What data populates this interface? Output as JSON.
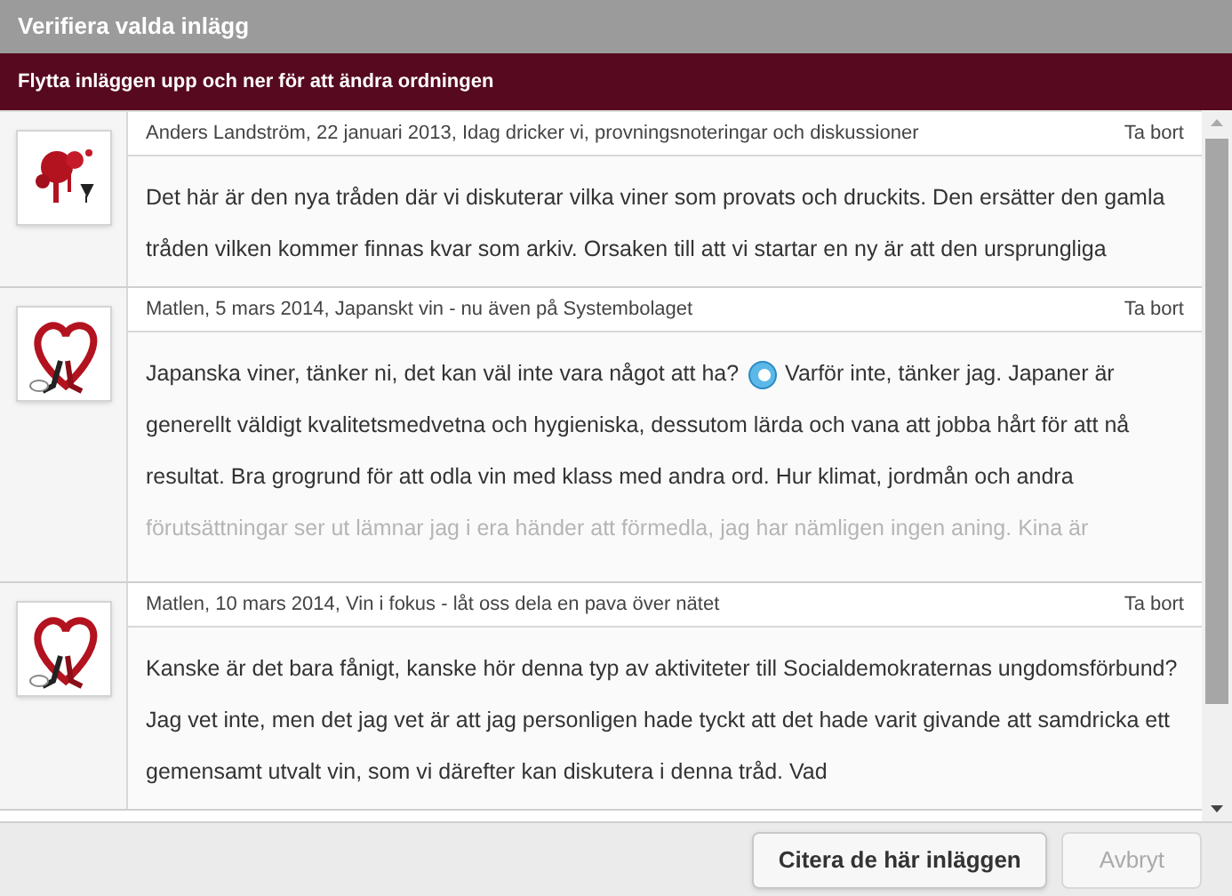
{
  "window": {
    "title": "Verifiera valda inlägg"
  },
  "banner": "Flytta inläggen upp och ner för att ändra ordningen",
  "posts": [
    {
      "avatar": {
        "kind": "splatter"
      },
      "header": "Anders Landström, 22 januari 2013, Idag dricker vi, provningsnoteringar och diskussioner",
      "remove": "Ta bort",
      "faded": false,
      "body": [
        {
          "kind": "text",
          "text": "Det här är den nya tråden där vi diskuterar vilka viner som provats och druckits. Den ersätter den gamla tråden vilken kommer finnas kvar som arkiv. Orsaken till att vi startar en ny är att den ursprungliga"
        }
      ]
    },
    {
      "avatar": {
        "kind": "heart"
      },
      "header": "Matlen, 5 mars 2014, Japanskt vin - nu även på Systembolaget",
      "remove": "Ta bort",
      "faded": true,
      "body": [
        {
          "kind": "text",
          "text": "Japanska viner, tänker ni, det kan väl inte vara något att ha?"
        },
        {
          "kind": "emoji"
        },
        {
          "kind": "text",
          "text": "Varför inte, tänker jag. Japaner är generellt väldigt kvalitetsmedvetna och hygieniska, dessutom lärda och vana att jobba hårt för att nå resultat. Bra grogrund för att odla vin med klass med andra ord. Hur klimat, jordmån och andra förutsättningar ser ut lämnar jag i era händer att förmedla, jag har nämligen ingen aning. Kina är"
        }
      ]
    },
    {
      "avatar": {
        "kind": "heart"
      },
      "header": "Matlen, 10 mars 2014, Vin i fokus - låt oss dela en pava över nätet",
      "remove": "Ta bort",
      "faded": false,
      "body": [
        {
          "kind": "text",
          "text": "Kanske är det bara fånigt, kanske hör denna typ av aktiviteter till Socialdemokraternas ungdomsförbund? Jag vet inte, men det jag vet är att jag personligen hade tyckt att det hade varit givande att samdricka ett gemensamt utvalt vin, som vi därefter kan diskutera i denna tråd. Vad"
        }
      ]
    }
  ],
  "buttons": [
    {
      "label": "Citera de här inläggen",
      "disabled": false
    },
    {
      "label": "Avbryt",
      "disabled": true
    }
  ]
}
